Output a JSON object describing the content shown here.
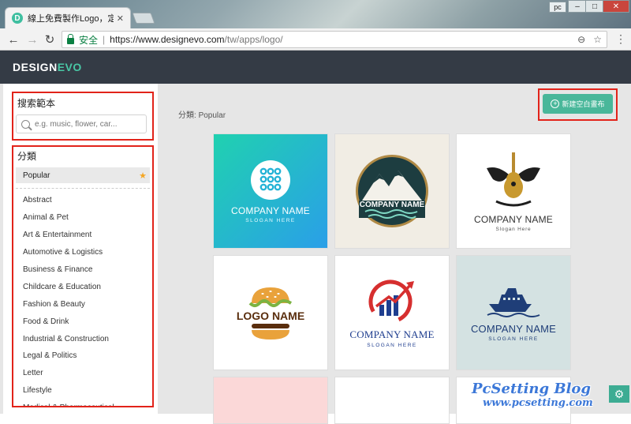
{
  "browser": {
    "tab_title": "線上免費製作Logo，定制",
    "tab_favicon": "D",
    "user": "pc",
    "secure_label": "安全",
    "url_host": "https://www.designevo.com",
    "url_path": "/tw/apps/logo/"
  },
  "app": {
    "logo_main": "DESIGN",
    "logo_accent": "EVO",
    "accent_color": "#49c7a5"
  },
  "sidebar": {
    "search_title": "搜索範本",
    "search_placeholder": "e.g. music, flower, car...",
    "categories_title": "分類",
    "active_category": "Popular",
    "categories": [
      "Abstract",
      "Animal & Pet",
      "Art & Entertainment",
      "Automotive & Logistics",
      "Business & Finance",
      "Childcare & Education",
      "Fashion & Beauty",
      "Food & Drink",
      "Industrial & Construction",
      "Legal & Politics",
      "Letter",
      "Lifestyle",
      "Medical & Pharmaceutical"
    ]
  },
  "content": {
    "category_prefix": "分類: ",
    "category_value": "Popular",
    "new_button": "新建空白畫布",
    "templates": [
      {
        "name": "COMPANY NAME",
        "slogan": "SLOGAN HERE",
        "icon": "dots-circle-icon"
      },
      {
        "name": "COMPANY NAME",
        "slogan": "",
        "icon": "mountain-icon"
      },
      {
        "name": "COMPANY NAME",
        "slogan": "Slogan Here",
        "icon": "winged-guitar-icon"
      },
      {
        "name": "LOGO NAME",
        "slogan": "",
        "icon": "burger-icon"
      },
      {
        "name": "COMPANY NAME",
        "slogan": "SLOGAN HERE",
        "icon": "growth-chart-icon"
      },
      {
        "name": "COMPANY NAME",
        "slogan": "SLOGAN HERE",
        "icon": "cruise-ship-icon"
      }
    ]
  },
  "watermark": {
    "title": "PcSetting Blog",
    "url": "www.pcsetting.com"
  }
}
